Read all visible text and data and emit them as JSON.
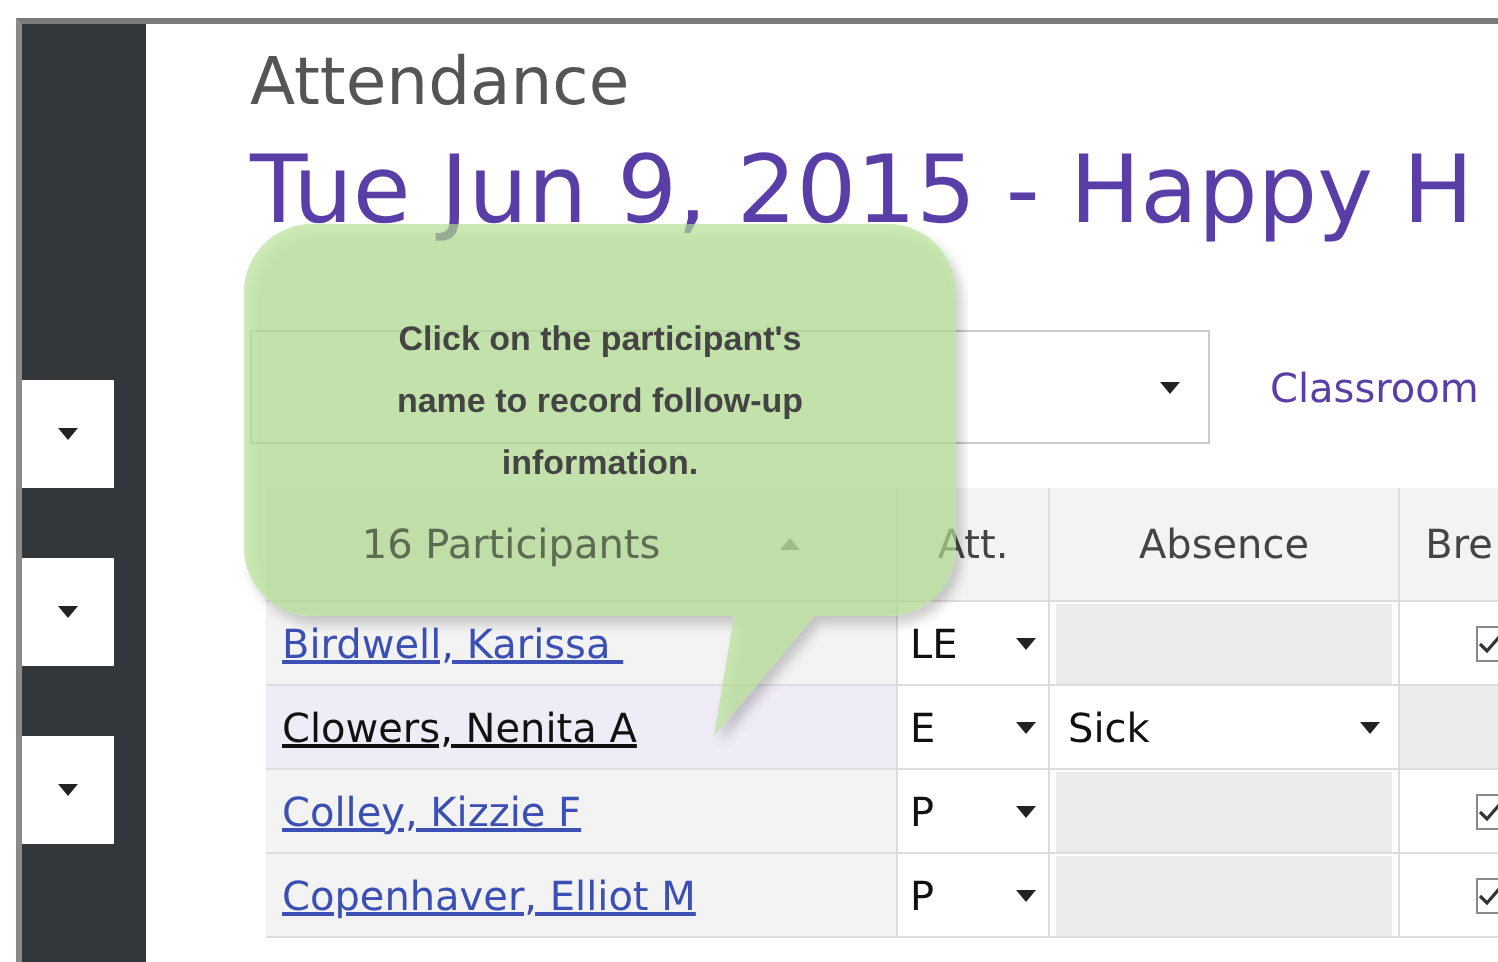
{
  "page_title": "Attendance",
  "event_title": "Tue Jun 9, 2015 - Happy H",
  "sidebar": {
    "dropdowns": [
      {
        "open": false
      },
      {
        "open": false
      },
      {
        "open": false
      }
    ]
  },
  "filter": {
    "link": "Classroom"
  },
  "callout": {
    "text": "Click on the participant's name to record follow-up information."
  },
  "table": {
    "columns": [
      {
        "label": "16 Participants",
        "sorted": true
      },
      {
        "label": "Att.",
        "sorted": false
      },
      {
        "label": "Absence",
        "sorted": false
      },
      {
        "label": "Bre",
        "sorted": false
      }
    ],
    "rows": [
      {
        "name": "Birdwell, Karissa ",
        "attendance": "LE",
        "absence": null,
        "breakfast": true,
        "selected": false
      },
      {
        "name": "Clowers, Nenita A",
        "attendance": "E",
        "absence": "Sick",
        "breakfast": null,
        "selected": true
      },
      {
        "name": "Colley, Kizzie F",
        "attendance": "P",
        "absence": null,
        "breakfast": true,
        "selected": false
      },
      {
        "name": "Copenhaver, Elliot M",
        "attendance": "P",
        "absence": null,
        "breakfast": true,
        "selected": false
      }
    ]
  }
}
